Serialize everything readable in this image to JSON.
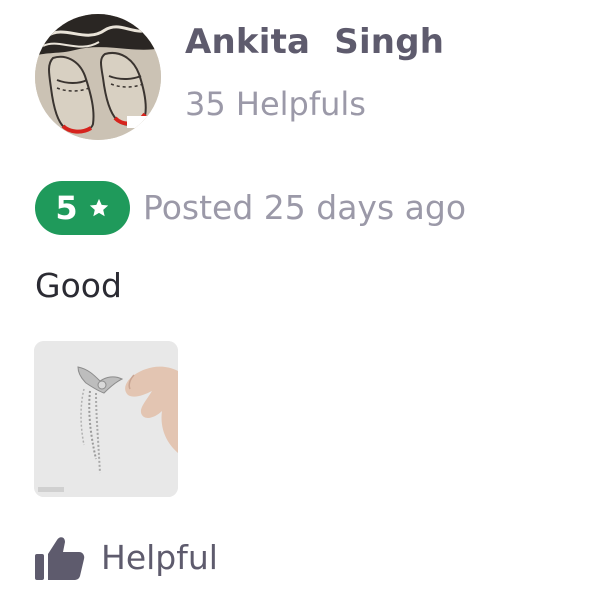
{
  "user": {
    "name": "Ankita  Singh",
    "helpful_count": "35 Helpfuls",
    "avatar_icon": "henna-feet-avatar"
  },
  "review": {
    "rating": "5",
    "rating_icon": "star-icon",
    "posted_time": "Posted 25 days ago",
    "text": "Good",
    "photo_icon": "earring-photo"
  },
  "actions": {
    "helpful_label": "Helpful",
    "helpful_icon": "thumbs-up-icon"
  },
  "colors": {
    "badge_green": "#1f9a5b",
    "name_text": "#5e5b6d",
    "muted_text": "#9b99a8"
  }
}
